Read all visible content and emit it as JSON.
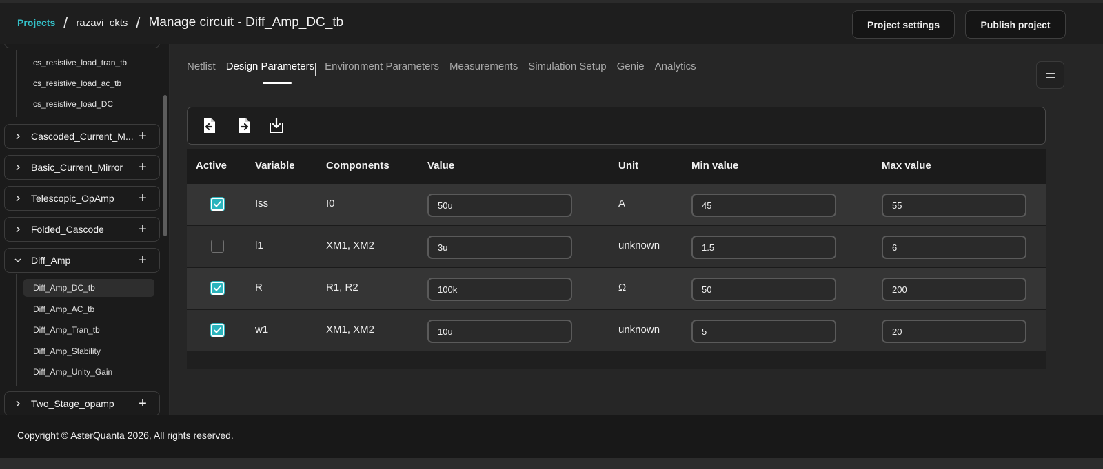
{
  "header": {
    "breadcrumb": {
      "projects": "Projects",
      "separator": "/",
      "project": "razavi_ckts",
      "page": "Manage circuit - Diff_Amp_DC_tb"
    },
    "buttons": {
      "project_settings": "Project settings",
      "publish_project": "Publish project"
    }
  },
  "sidebar": {
    "top_sub_items": [
      "cs_resistive_load_tran_tb",
      "cs_resistive_load_ac_tb",
      "cs_resistive_load_DC"
    ],
    "folders": [
      {
        "name": "Cascoded_Current_M...",
        "expanded": false
      },
      {
        "name": "Basic_Current_Mirror",
        "expanded": false
      },
      {
        "name": "Telescopic_OpAmp",
        "expanded": false
      },
      {
        "name": "Folded_Cascode",
        "expanded": false
      },
      {
        "name": "Diff_Amp",
        "expanded": true
      },
      {
        "name": "Two_Stage_opamp",
        "expanded": false
      }
    ],
    "diff_amp_items": [
      "Diff_Amp_DC_tb",
      "Diff_Amp_AC_tb",
      "Diff_Amp_Tran_tb",
      "Diff_Amp_Stability",
      "Diff_Amp_Unity_Gain"
    ],
    "active_item": "Diff_Amp_DC_tb"
  },
  "tabs": [
    "Netlist",
    "Design Parameters",
    "Environment Parameters",
    "Measurements",
    "Simulation Setup",
    "Genie",
    "Analytics"
  ],
  "active_tab": "Design Parameters",
  "toolbar": {
    "icons": [
      "import-file-icon",
      "export-file-icon",
      "download-icon"
    ]
  },
  "table": {
    "columns": [
      "Active",
      "Variable",
      "Components",
      "Value",
      "Unit",
      "Min value",
      "Max value"
    ],
    "rows": [
      {
        "active": true,
        "variable": "Iss",
        "components": "I0",
        "value": "50u",
        "unit": "A",
        "min": "45",
        "max": "55"
      },
      {
        "active": false,
        "variable": "l1",
        "components": "XM1, XM2",
        "value": "3u",
        "unit": "unknown",
        "min": "1.5",
        "max": "6"
      },
      {
        "active": true,
        "variable": "R",
        "components": "R1, R2",
        "value": "100k",
        "unit": "Ω",
        "min": "50",
        "max": "200"
      },
      {
        "active": true,
        "variable": "w1",
        "components": "XM1, XM2",
        "value": "10u",
        "unit": "unknown",
        "min": "5",
        "max": "20"
      }
    ]
  },
  "footer": {
    "copyright": "Copyright © AsterQuanta 2026, All rights reserved."
  },
  "colors": {
    "accent": "#34c1c9",
    "checkbox": "#2bb4bd",
    "background": "#262626"
  }
}
